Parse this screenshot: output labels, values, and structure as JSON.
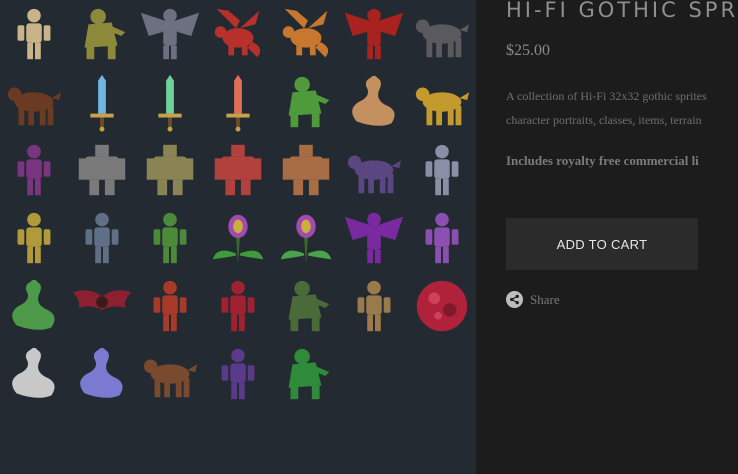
{
  "product": {
    "title": "HI-FI GOTHIC SPR",
    "price": "$25.00",
    "description_line1": "A collection of Hi-Fi 32x32 gothic sprites",
    "description_line2": "character portraits, classes, items, terrain",
    "license_text": "Includes royalty free commercial li",
    "add_to_cart_label": "ADD TO CART",
    "share_label": "Share"
  },
  "colors": {
    "gallery_bg": "#242a31",
    "panel_bg": "#1c1c1c",
    "button_bg": "#2b2b2b"
  },
  "gallery": {
    "sprites": [
      {
        "name": "skeleton",
        "color": "#c9b48a",
        "kind": "humanoid"
      },
      {
        "name": "swamp-ghoul",
        "color": "#8c8a3a",
        "kind": "beast"
      },
      {
        "name": "horned-gargoyle",
        "color": "#6d7080",
        "kind": "winged"
      },
      {
        "name": "red-dragon",
        "color": "#b8302c",
        "kind": "dragon"
      },
      {
        "name": "orange-dragon",
        "color": "#c8772e",
        "kind": "dragon"
      },
      {
        "name": "red-demon",
        "color": "#a8231f",
        "kind": "winged"
      },
      {
        "name": "grey-wolf",
        "color": "#5a5a5e",
        "kind": "quad"
      },
      {
        "name": "brown-horse",
        "color": "#6b3a22",
        "kind": "quad"
      },
      {
        "name": "blue-sword",
        "color": "#6fb6e6",
        "kind": "sword"
      },
      {
        "name": "green-sword",
        "color": "#6dd39a",
        "kind": "sword"
      },
      {
        "name": "red-sword",
        "color": "#e06f5a",
        "kind": "sword"
      },
      {
        "name": "mantis",
        "color": "#4f9a3a",
        "kind": "beast"
      },
      {
        "name": "naga-warrior",
        "color": "#c59060",
        "kind": "serpent"
      },
      {
        "name": "chimera-lion",
        "color": "#c49a2e",
        "kind": "quad"
      },
      {
        "name": "purple-knight",
        "color": "#7a3580",
        "kind": "humanoid"
      },
      {
        "name": "iron-golem",
        "color": "#7a7a7a",
        "kind": "golem"
      },
      {
        "name": "stone-golem",
        "color": "#8a8455",
        "kind": "golem"
      },
      {
        "name": "flesh-golem",
        "color": "#b2403d",
        "kind": "golem"
      },
      {
        "name": "clay-golem",
        "color": "#a86d45",
        "kind": "golem"
      },
      {
        "name": "dire-rat",
        "color": "#5a4680",
        "kind": "quad"
      },
      {
        "name": "flail-knight",
        "color": "#8a8fa6",
        "kind": "humanoid"
      },
      {
        "name": "gold-knight",
        "color": "#b09a3a",
        "kind": "humanoid"
      },
      {
        "name": "steel-knight",
        "color": "#5f6f86",
        "kind": "humanoid"
      },
      {
        "name": "orc-warrior",
        "color": "#4c8a3a",
        "kind": "humanoid"
      },
      {
        "name": "man-eater-plant",
        "color": "#3f9a3a",
        "kind": "plant"
      },
      {
        "name": "venus-flytrap",
        "color": "#4aa34a",
        "kind": "plant"
      },
      {
        "name": "succubus",
        "color": "#7a2aa0",
        "kind": "winged"
      },
      {
        "name": "sorcerer",
        "color": "#8a4fb0",
        "kind": "humanoid"
      },
      {
        "name": "medusa",
        "color": "#4c9a4a",
        "kind": "serpent"
      },
      {
        "name": "vampire-bat",
        "color": "#8c2030",
        "kind": "bat"
      },
      {
        "name": "reaper",
        "color": "#a83a2a",
        "kind": "humanoid"
      },
      {
        "name": "vampire-lord",
        "color": "#a02230",
        "kind": "humanoid"
      },
      {
        "name": "werebeast",
        "color": "#4a6a3a",
        "kind": "beast"
      },
      {
        "name": "mummy",
        "color": "#9a7a4a",
        "kind": "humanoid"
      },
      {
        "name": "flesh-orb",
        "color": "#b0223a",
        "kind": "orb"
      },
      {
        "name": "bone-wyrm",
        "color": "#c8c8c8",
        "kind": "serpent"
      },
      {
        "name": "bone-centipede",
        "color": "#7a7ad0",
        "kind": "serpent"
      },
      {
        "name": "hellhound",
        "color": "#7a4a2e",
        "kind": "quad"
      },
      {
        "name": "dark-elf",
        "color": "#5a3a8a",
        "kind": "humanoid"
      },
      {
        "name": "green-lizardman",
        "color": "#2f8a3a",
        "kind": "beast"
      }
    ]
  }
}
